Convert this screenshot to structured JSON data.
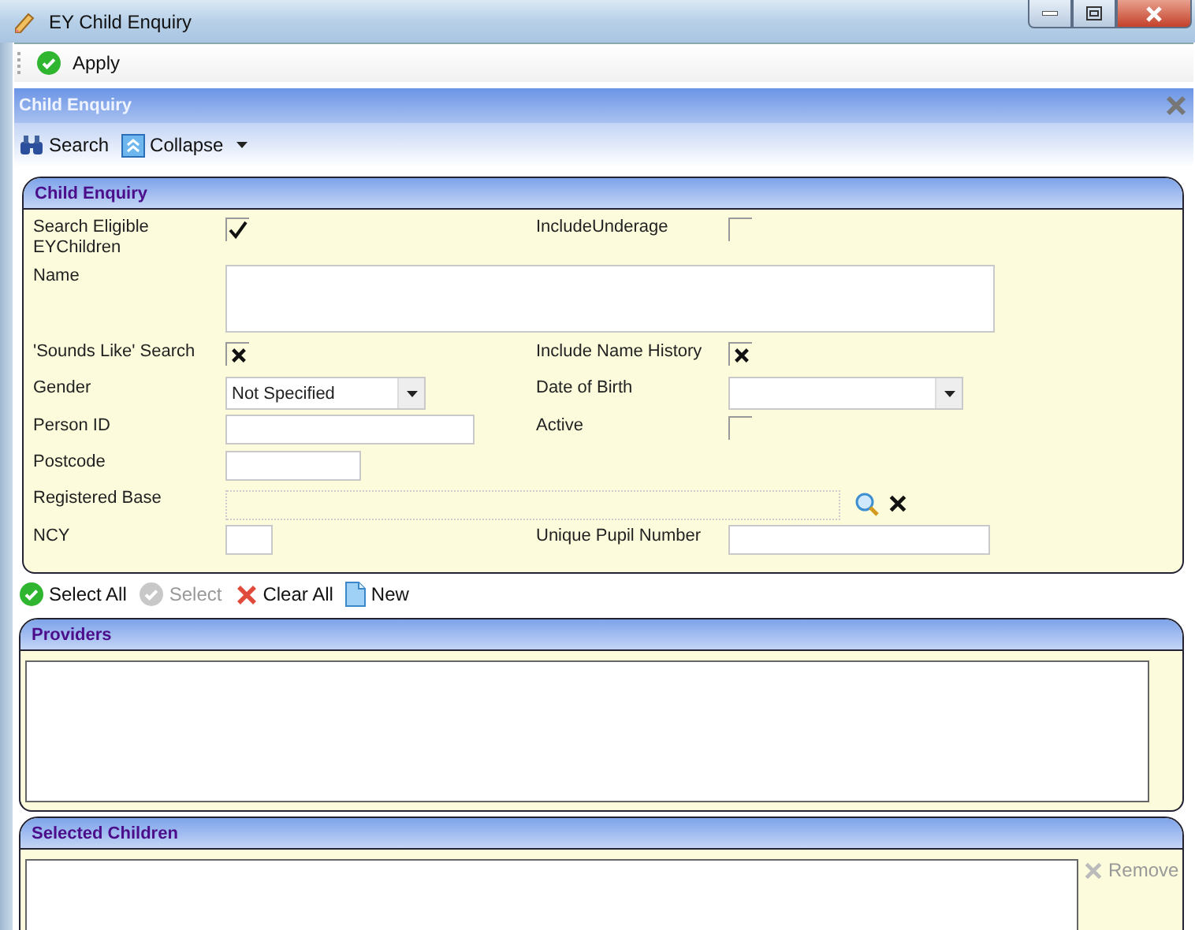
{
  "window": {
    "title": "EY Child Enquiry"
  },
  "toolbar": [
    {
      "label": "Apply",
      "disabled": false
    }
  ],
  "panel": {
    "title": "Child Enquiry",
    "tools": [
      {
        "kind": "search",
        "label": "Search"
      },
      {
        "kind": "collapse",
        "label": "Collapse"
      }
    ]
  },
  "form": {
    "title": "Child Enquiry",
    "rows": [
      [
        {
          "label": "Search Eligible EYChildren",
          "kind": "tickbox",
          "checked": true
        },
        {
          "label": "IncludeUnderage",
          "kind": "tickbox",
          "checked": false
        }
      ],
      [
        {
          "label": "Name",
          "kind": "multiline"
        }
      ],
      [
        {
          "label": "'Sounds Like' Search",
          "kind": "crossbox",
          "checked": true
        },
        {
          "label": "Include Name History",
          "kind": "crossbox",
          "checked": true
        }
      ],
      [
        {
          "label": "Gender",
          "kind": "select",
          "value": "Not Specified"
        },
        {
          "label": "Date of Birth",
          "kind": "select"
        }
      ],
      [
        {
          "label": "Person ID",
          "kind": "text"
        },
        {
          "label": "Active",
          "kind": "tickbox",
          "checked": false
        }
      ],
      [
        {
          "label": "Postcode",
          "kind": "text"
        }
      ],
      [
        {
          "label": "Registered Base",
          "kind": "lookup"
        }
      ],
      [
        {
          "label": "NCY",
          "kind": "text"
        },
        {
          "label": "Unique Pupil Number",
          "kind": "text"
        }
      ]
    ]
  },
  "actions": [
    {
      "kind": "select-all",
      "label": "Select All",
      "disabled": false
    },
    {
      "kind": "select",
      "label": "Select",
      "disabled": true
    },
    {
      "kind": "clear",
      "label": "Clear All",
      "disabled": false
    },
    {
      "kind": "new",
      "label": "New",
      "disabled": false
    }
  ],
  "providers": {
    "title": "Providers"
  },
  "selected_children": {
    "title": "Selected Children",
    "remove": {
      "label": "Remove",
      "disabled": true
    }
  }
}
